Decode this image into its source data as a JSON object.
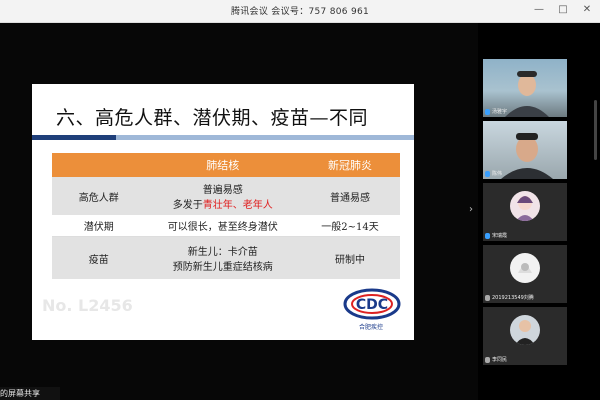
{
  "window": {
    "title": "腾讯会议  会议号：757 806 961"
  },
  "slide": {
    "title": "六、高危人群、潜伏期、疫苗—不同",
    "watermark": "No. L2456",
    "logo_text": "合肥疾控",
    "table": {
      "headers": [
        "",
        "肺结核",
        "新冠肺炎"
      ],
      "rows": [
        {
          "label": "高危人群",
          "tb_line1": "普遍易感",
          "tb_line2_prefix": "多发于",
          "tb_line2_highlight": "青壮年、老年人",
          "covid": "普通易感"
        },
        {
          "label": "潜伏期",
          "tb_line1": "可以很长，甚至终身潜伏",
          "covid": "一般2~14天"
        },
        {
          "label": "疫苗",
          "tb_line1": "新生儿：卡介苗",
          "tb_line2": "预防新生儿重症结核病",
          "covid": "研制中"
        }
      ]
    }
  },
  "status": {
    "share_label": "的屏幕共享"
  },
  "participants": [
    {
      "name": "汤雅宇",
      "mic": "on"
    },
    {
      "name": "陈伟",
      "mic": "on"
    },
    {
      "name": "宋瑞霞",
      "mic": "on"
    },
    {
      "name": "2019213549刘腾",
      "mic": "off"
    },
    {
      "name": "李同民",
      "mic": "off"
    }
  ],
  "colors": {
    "header_orange": "#ec8f3a",
    "highlight_red": "#e02020",
    "bar_navy": "#1f3f7a",
    "bar_light": "#9fb8d8"
  }
}
